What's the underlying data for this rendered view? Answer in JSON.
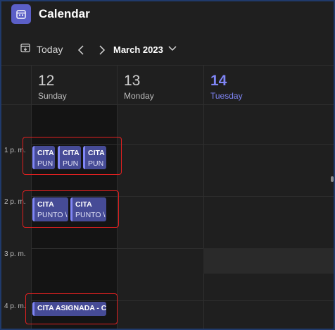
{
  "app": {
    "title": "Calendar",
    "icon": "calendar-icon",
    "accent": "#5b5fc7"
  },
  "toolbar": {
    "today_label": "Today",
    "today_icon": "calendar-today-icon",
    "prev_icon": "chevron-left-icon",
    "next_icon": "chevron-right-icon",
    "month_label": "March 2023",
    "month_dropdown_icon": "chevron-down-icon"
  },
  "days": [
    {
      "number": "12",
      "name": "Sunday",
      "is_today": false
    },
    {
      "number": "13",
      "name": "Monday",
      "is_today": false
    },
    {
      "number": "14",
      "name": "Tuesday",
      "is_today": true
    }
  ],
  "time_labels": [
    "1 p. m.",
    "2 p. m.",
    "3 p. m.",
    "4 p. m."
  ],
  "events": [
    {
      "line1": "CITA",
      "line2": "PUN"
    },
    {
      "line1": "CITA",
      "line2": "PUN"
    },
    {
      "line1": "CITA",
      "line2": "PUN"
    },
    {
      "line1": "CITA",
      "line2": "PUNTO \\"
    },
    {
      "line1": "CITA",
      "line2": "PUNTO \\"
    },
    {
      "line1": "CITA ASIGNADA - CI",
      "line2": ""
    }
  ],
  "colors": {
    "event_fill": "#464b96",
    "event_border": "#7f85f5",
    "today": "#7f85f5",
    "highlight": "#e02020"
  }
}
